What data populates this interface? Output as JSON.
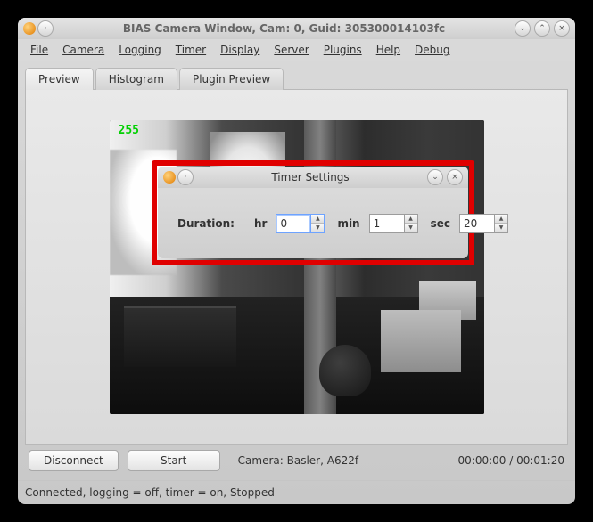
{
  "window": {
    "title": "BIAS Camera Window, Cam: 0, Guid: 305300014103fc"
  },
  "menu": {
    "file": "File",
    "camera": "Camera",
    "logging": "Logging",
    "timer": "Timer",
    "display": "Display",
    "server": "Server",
    "plugins": "Plugins",
    "help": "Help",
    "debug": "Debug"
  },
  "tabs": {
    "preview": "Preview",
    "histogram": "Histogram",
    "plugin_preview": "Plugin Preview"
  },
  "preview": {
    "pixel_value": "255"
  },
  "actions": {
    "disconnect": "Disconnect",
    "start": "Start"
  },
  "status": {
    "camera_label": "Camera:  Basler,  A622f",
    "time": "00:00:00 / 00:01:20",
    "line": "Connected, logging = off, timer = on, Stopped"
  },
  "timer_dialog": {
    "title": "Timer Settings",
    "duration_label": "Duration:",
    "hr_label": "hr",
    "min_label": "min",
    "sec_label": "sec",
    "hr": "0",
    "min": "1",
    "sec": "20"
  }
}
